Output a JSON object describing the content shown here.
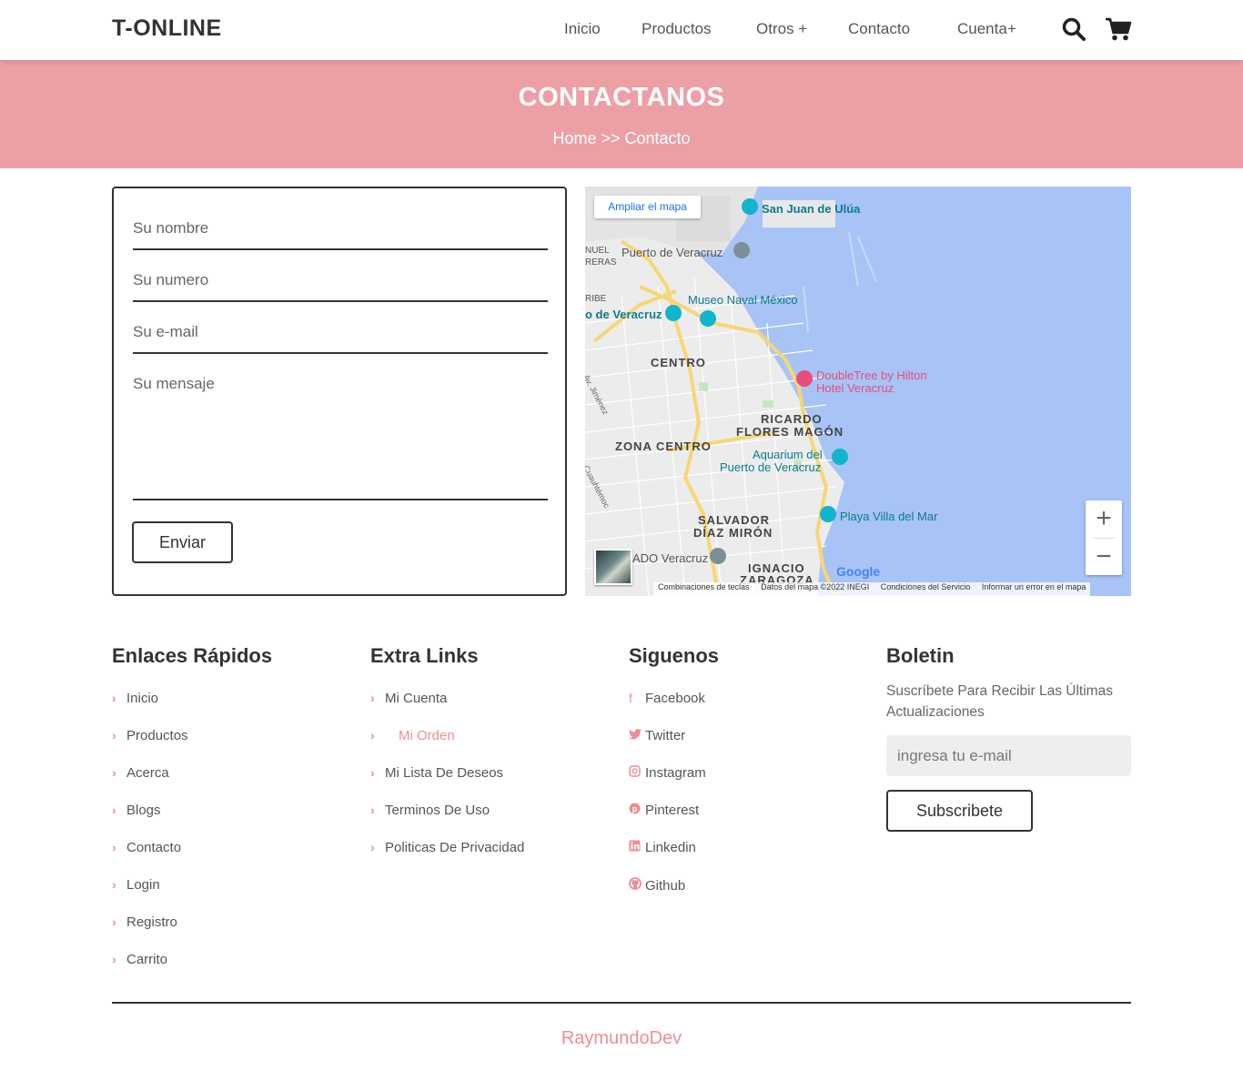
{
  "header": {
    "logo": "T-ONLINE",
    "nav": [
      "Inicio",
      "Productos",
      "Otros +",
      "Contacto",
      "Cuenta+"
    ],
    "search_icon": "search-icon",
    "cart_icon": "cart-icon"
  },
  "banner": {
    "title": "CONTACTANOS",
    "breadcrumb": "Home >> Contacto"
  },
  "form": {
    "name_placeholder": "Su nombre",
    "phone_placeholder": "Su numero",
    "email_placeholder": "Su e-mail",
    "message_placeholder": "Su mensaje",
    "submit_label": "Enviar"
  },
  "map": {
    "expand_label": "Ampliar el mapa",
    "zoom_in": "+",
    "zoom_out": "−",
    "labels": {
      "san_juan": "San Juan de Ulúa",
      "puerto": "Puerto de Veracruz",
      "museo": "Museo Naval México",
      "veracruz_left": "o de Veracruz",
      "centro": "CENTRO",
      "doubletree_1": "DoubleTree by Hilton",
      "doubletree_2": "Hotel Veracruz",
      "ricardo": "RICARDO",
      "flores": "FLORES MAGÓN",
      "zona_centro": "ZONA CENTRO",
      "aquarium_1": "Aquarium del",
      "aquarium_2": "Puerto de Veracruz",
      "playa": "Playa Villa del Mar",
      "salvador": "SALVADOR",
      "diaz": "DÍAZ MIRÓN",
      "ado": "ADO Veracruz",
      "ignacio": "IGNACIO",
      "zaragoza": "ZARAGOZA",
      "nuel": "NUEL",
      "reras": "RERAS",
      "ribe": "RIBE",
      "av_jimenez": "Av. Jiménez",
      "cuauhtemoc": "Cuauhtémoc",
      "google": "Google"
    },
    "footer": [
      "Combinaciones de teclas",
      "Datos del mapa ©2022 INEGI",
      "Condiciones del Servicio",
      "Informar un error en el mapa"
    ]
  },
  "footer": {
    "quick_links": {
      "title": "Enlaces Rápidos",
      "items": [
        "Inicio",
        "Productos",
        "Acerca",
        "Blogs",
        "Contacto",
        "Login",
        "Registro",
        "Carrito"
      ]
    },
    "extra_links": {
      "title": "Extra Links",
      "items": [
        "Mi Cuenta",
        "Mi Orden",
        "Mi Lista De Deseos",
        "Terminos De Uso",
        "Politicas De Privacidad"
      ]
    },
    "social": {
      "title": "Siguenos",
      "items": [
        {
          "label": "Facebook",
          "icon": "facebook-icon"
        },
        {
          "label": "Twitter",
          "icon": "twitter-icon"
        },
        {
          "label": "Instagram",
          "icon": "instagram-icon"
        },
        {
          "label": "Pinterest",
          "icon": "pinterest-icon"
        },
        {
          "label": "Linkedin",
          "icon": "linkedin-icon"
        },
        {
          "label": "Github",
          "icon": "github-icon"
        }
      ]
    },
    "newsletter": {
      "title": "Boletin",
      "text": "Suscríbete Para Recibir Las Últimas Actualizaciones",
      "placeholder": "ingresa tu e-mail",
      "button": "Subscribete"
    },
    "credit": "RaymundoDev"
  },
  "colors": {
    "accent": "#eca0a6",
    "link_accent": "#e88f97",
    "text_dark": "#333333"
  }
}
